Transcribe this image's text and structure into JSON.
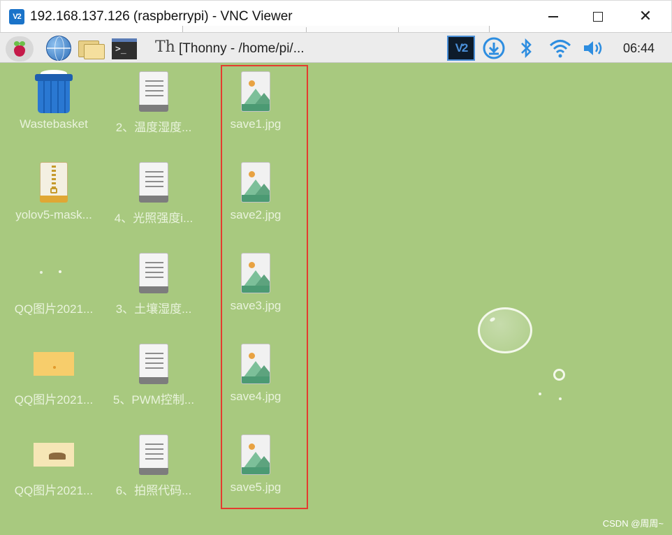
{
  "window": {
    "app_logo": "V2",
    "title": "192.168.137.126 (raspberrypi) - VNC Viewer",
    "controls": [
      "minimize-icon",
      "maximize-icon",
      "close-icon"
    ],
    "close_glyph": "✕"
  },
  "panel": {
    "launchers": [
      "raspberry-menu-icon",
      "web-browser-icon",
      "file-manager-icon",
      "terminal-icon"
    ],
    "terminal_glyph": ">_",
    "thonny_glyph": "Th",
    "task_label": "[Thonny  -  /home/pi/...",
    "tray": {
      "vnc_label": "V2",
      "bluetooth_glyph": "✱",
      "volume_glyph": "🔊"
    },
    "clock": "06:44"
  },
  "desktop": {
    "background": "#a8c97f",
    "icons": [
      {
        "label": "Wastebasket",
        "kind": "trash"
      },
      {
        "label": "2、温度湿度...",
        "kind": "document"
      },
      {
        "label": "save1.jpg",
        "kind": "image"
      },
      {
        "label": "yolov5-mask...",
        "kind": "zip"
      },
      {
        "label": "4、光照强度i...",
        "kind": "document"
      },
      {
        "label": "save2.jpg",
        "kind": "image"
      },
      {
        "label": "QQ图片2021...",
        "kind": "thumbnail-blank"
      },
      {
        "label": "3、土壤湿度...",
        "kind": "document"
      },
      {
        "label": "save3.jpg",
        "kind": "image"
      },
      {
        "label": "QQ图片2021...",
        "kind": "thumbnail-yellow"
      },
      {
        "label": "5、PWM控制...",
        "kind": "document"
      },
      {
        "label": "save4.jpg",
        "kind": "image"
      },
      {
        "label": "QQ图片2021...",
        "kind": "thumbnail-cream"
      },
      {
        "label": "6、拍照代码...",
        "kind": "document"
      },
      {
        "label": "save5.jpg",
        "kind": "image"
      }
    ],
    "selection_color": "#e43b2f"
  },
  "watermark": "CSDN @周周~"
}
